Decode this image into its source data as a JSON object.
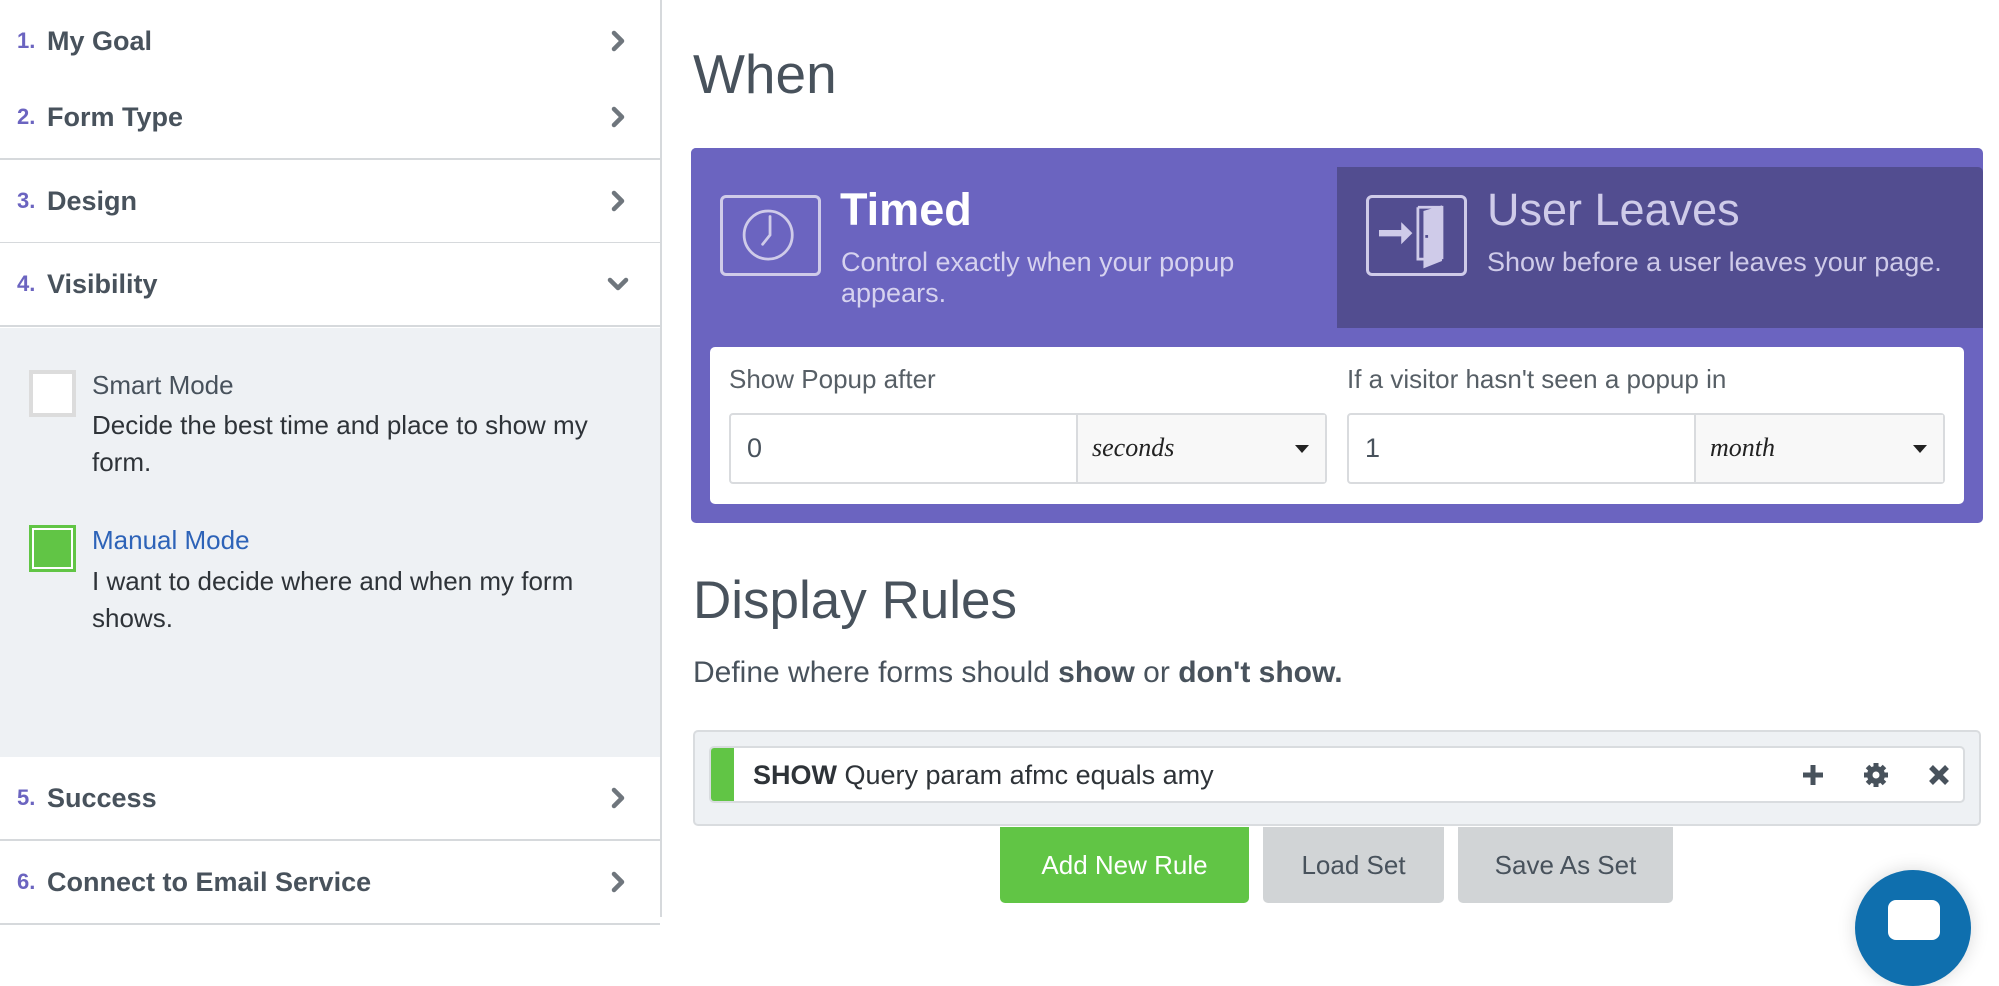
{
  "sidebar": {
    "steps": [
      {
        "number": "1.",
        "label": "My Goal",
        "state": "collapsed"
      },
      {
        "number": "2.",
        "label": "Form Type",
        "state": "collapsed"
      },
      {
        "number": "3.",
        "label": "Design",
        "state": "collapsed"
      },
      {
        "number": "4.",
        "label": "Visibility",
        "state": "expanded"
      },
      {
        "number": "5.",
        "label": "Success",
        "state": "collapsed"
      },
      {
        "number": "6.",
        "label": "Connect to Email Service",
        "state": "collapsed"
      }
    ],
    "visibility": {
      "smart_mode": {
        "title": "Smart Mode",
        "description": "Decide the best time and place to show my form.",
        "checked": false
      },
      "manual_mode": {
        "title": "Manual Mode",
        "description": "I want to decide where and when my form shows.",
        "checked": true
      }
    }
  },
  "when": {
    "title": "When",
    "tabs": [
      {
        "title": "Timed",
        "description": "Control exactly when your popup appears.",
        "icon": "clock-icon",
        "active": true
      },
      {
        "title": "User Leaves",
        "description": "Show before a user leaves your page.",
        "icon": "exit-door-icon",
        "active": false
      }
    ],
    "show_after": {
      "label": "Show Popup after",
      "value": "0",
      "unit": "seconds"
    },
    "not_seen": {
      "label": "If a visitor hasn't seen a popup in",
      "value": "1",
      "unit": "month"
    }
  },
  "display_rules": {
    "title": "Display Rules",
    "subtitle_pre": "Define where forms should ",
    "subtitle_show": "show",
    "subtitle_mid": " or ",
    "subtitle_dont": "don't show.",
    "rules": [
      {
        "action": "SHOW",
        "condition": "Query param afmc equals amy"
      }
    ],
    "buttons": {
      "add": "Add New Rule",
      "load": "Load Set",
      "save": "Save As Set"
    }
  },
  "colors": {
    "accent_purple": "#6b64c0",
    "inactive_tab": "#524d90",
    "success_green": "#61c545",
    "link_blue": "#2d63b8",
    "chat_blue": "#0f6fae"
  }
}
